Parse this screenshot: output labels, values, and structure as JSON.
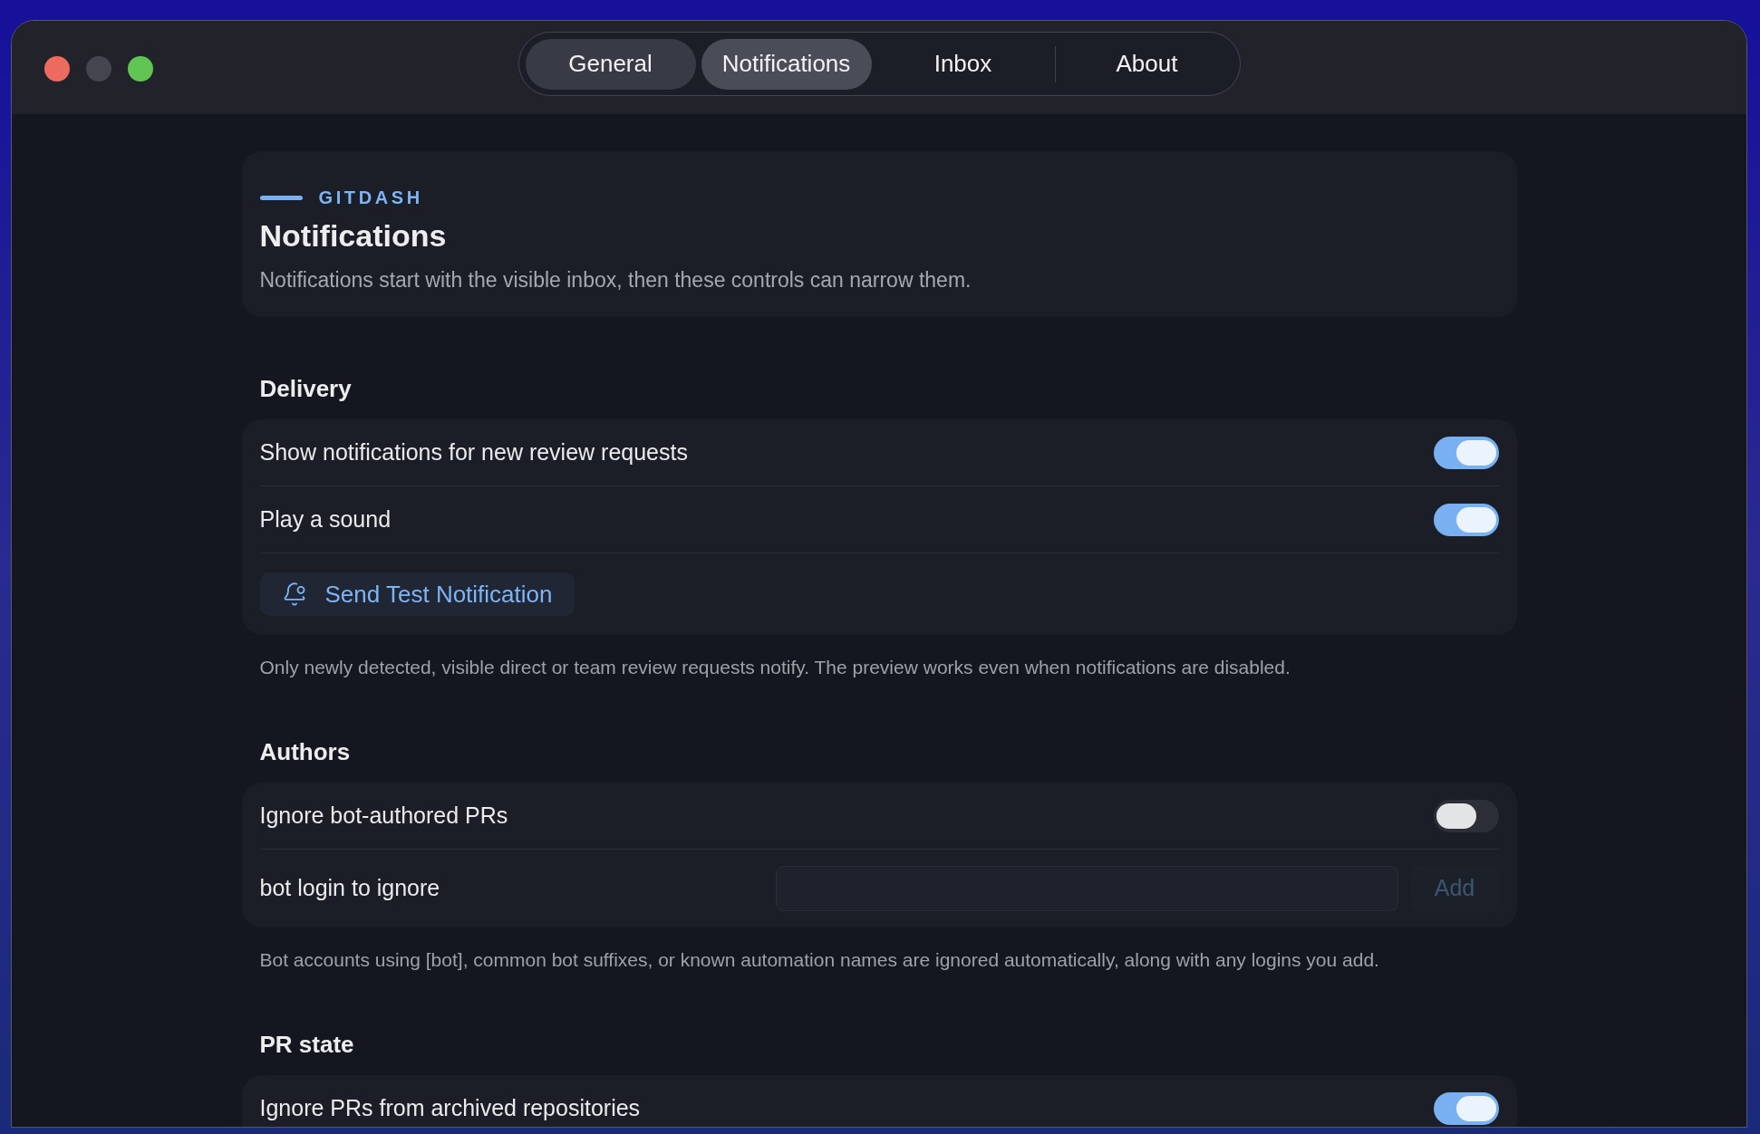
{
  "window": {
    "traffic_lights": [
      {
        "color": "#ec6a5e"
      },
      {
        "color": "#45454f"
      },
      {
        "color": "#61c554"
      }
    ]
  },
  "tabs": [
    {
      "label": "General",
      "selected": false,
      "kind": "pill"
    },
    {
      "label": "Notifications",
      "selected": true,
      "kind": "pill"
    },
    {
      "label": "Inbox",
      "selected": false,
      "kind": "plain"
    },
    {
      "label": "About",
      "selected": false,
      "kind": "plain"
    }
  ],
  "header": {
    "eyebrow": "GITDASH",
    "title": "Notifications",
    "description": "Notifications start with the visible inbox, then these controls can narrow them."
  },
  "sections": [
    {
      "title": "Delivery",
      "rows": [
        {
          "kind": "toggle",
          "label": "Show notifications for new review requests",
          "on": true
        },
        {
          "kind": "toggle",
          "label": "Play a sound",
          "on": true
        },
        {
          "kind": "action",
          "label": "Send Test Notification"
        }
      ],
      "note": "Only newly detected, visible direct or team review requests notify. The preview works even when notifications are disabled."
    },
    {
      "title": "Authors",
      "rows": [
        {
          "kind": "toggle",
          "label": "Ignore bot-authored PRs",
          "on": false
        },
        {
          "kind": "input",
          "label": "bot login to ignore",
          "button": "Add",
          "disabled": true
        }
      ],
      "note": "Bot accounts using [bot], common bot suffixes, or known automation names are ignored automatically, along with any logins you add."
    },
    {
      "title": "PR state",
      "rows": [
        {
          "kind": "toggle",
          "label": "Ignore PRs from archived repositories",
          "on": true
        }
      ]
    }
  ]
}
